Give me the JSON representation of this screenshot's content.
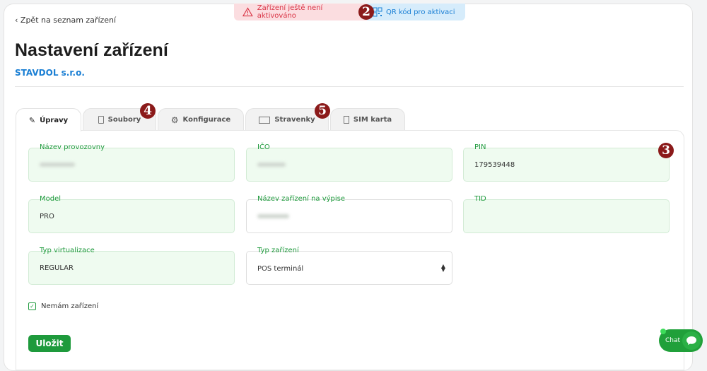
{
  "nav": {
    "back_label": "Zpět na seznam zařízení"
  },
  "page": {
    "title": "Nastavení zařízení",
    "company": "STAVDOL s.r.o."
  },
  "banner": {
    "warning": "Zařízení ještě není aktivováno",
    "qr_link": "QR kód pro aktivaci",
    "warning_color": "#d93445",
    "qr_color": "#1a7fd4"
  },
  "markers": [
    "2",
    "3",
    "4",
    "5"
  ],
  "tabs": [
    {
      "label": "Úpravy",
      "icon": "edit-icon",
      "active": true
    },
    {
      "label": "Soubory",
      "icon": "file-icon"
    },
    {
      "label": "Konfigurace",
      "icon": "gear-icon"
    },
    {
      "label": "Stravenky",
      "icon": "tray-icon"
    },
    {
      "label": "SIM karta",
      "icon": "sim-card-icon"
    }
  ],
  "fields": {
    "nazev_provozovny": {
      "label": "Název provozovny"
    },
    "ico": {
      "label": "IČO"
    },
    "pin": {
      "label": "PIN",
      "value": "179539448"
    },
    "model": {
      "label": "Model",
      "value": "PRO"
    },
    "nazev_vypis": {
      "label": "Název zařízení na výpise"
    },
    "tid": {
      "label": "TID",
      "value": ""
    },
    "typ_virtualizace": {
      "label": "Typ virtualizace",
      "value": "REGULAR"
    },
    "typ_zarizeni": {
      "label": "Typ zařízení",
      "value": "POS terminál"
    }
  },
  "checkbox": {
    "label": "Nemám zařízení",
    "checked": true
  },
  "save_label": "Uložit",
  "chat_label": "Chat",
  "accent": "#1e9a3c"
}
